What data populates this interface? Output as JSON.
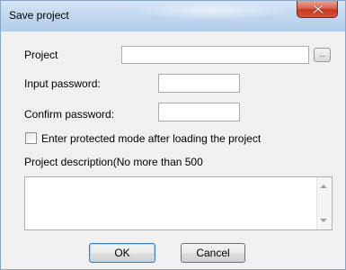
{
  "window": {
    "title": "Save project"
  },
  "form": {
    "project_label": "Project",
    "project_value": "",
    "browse_label": "...",
    "input_password_label": "Input password:",
    "input_password_value": "",
    "confirm_password_label": "Confirm password:",
    "confirm_password_value": "",
    "protected_mode_label": "Enter protected mode after loading the project",
    "protected_mode_checked": false,
    "description_label": "Project description(No more than 500",
    "description_value": ""
  },
  "buttons": {
    "ok_label": "OK",
    "cancel_label": "Cancel"
  },
  "icons": {
    "close": "close-icon",
    "scroll_up": "scroll-up-arrow-icon",
    "scroll_down": "scroll-down-arrow-icon"
  },
  "colors": {
    "title_bar": "#c2d8ef",
    "close_button": "#c7391c",
    "dialog_background": "#f0f0f0",
    "default_button_border": "#3c7fb1"
  }
}
